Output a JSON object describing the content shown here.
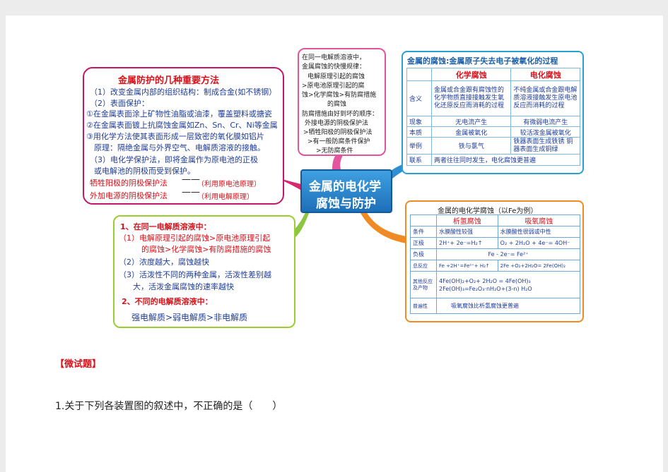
{
  "center": {
    "line1": "金属的电化学",
    "line2": "腐蚀与防护"
  },
  "protection": {
    "title": "金属防护的几种重要方法",
    "lines": [
      "（1）改变金属内部的组织结构：制成合金(如不锈钢）",
      "（2）表面保护：",
      "①在金属表面涂上矿物性油脂或油漆，覆盖塑料或搪瓷",
      "②在金属表面镀上抗腐蚀金属如Zn、Sn、Cr、Ni等金属",
      "③用化学方法使其表面形成一层致密的氧化膜如铝片",
      "原理：隔绝金属与外界空气、电解质溶液的接触。",
      "（3）电化学保护法，即将金属作为原电池的正极",
      "或电解池的阴极而受到保护。"
    ],
    "sac": "牺牲阳极的阴极保护法",
    "sac_note": "（利用原电池原理）",
    "ext": "外加电源的阴极保护法",
    "ext_note": "（利用电解原理）"
  },
  "rules": {
    "lines": [
      "在同一电解质溶液中，",
      "金属腐蚀的快慢规律：",
      "电解原理引起的腐蚀",
      ">原电池原理引起的腐",
      "蚀>化学腐蚀>有防腐措施",
      "的腐蚀",
      "防腐措施由好到坏的顺序：",
      "外接电源的阴极保护法",
      ">牺牲阳极的阴极保护法",
      ">有一般防腐条件保护",
      ">无防腐条件"
    ]
  },
  "corrosion_table": {
    "title": "金属的腐蚀:金属原子失去电子被氧化的过程",
    "headers": [
      "化学腐蚀",
      "电化腐蚀"
    ],
    "rows": [
      {
        "label": "含义",
        "a": "金属或合金跟有腐蚀性的化学物质直接接触发生氧化还原反应而消耗的过程",
        "b": "不纯金属或合金跟电解质溶液接触发生原电池反应而消耗的过程"
      },
      {
        "label": "现象",
        "a": "无电流产生",
        "b": "有微弱电流产生"
      },
      {
        "label": "本质",
        "a": "金属被氧化",
        "b": "较活泼金属被氧化"
      },
      {
        "label": "举例",
        "a": "铁与氯气",
        "b": "铁器表面生成铁锈 铜器表面生成铜绿"
      },
      {
        "label": "联系",
        "a": "两者往往同时发生，电化腐蚀更普遍",
        "b": ""
      }
    ]
  },
  "speed": {
    "title1": "1、在同一电解质溶液中：",
    "l1": "（1）电解原理引起的腐蚀>原电池原理引起",
    "l1b": "的腐蚀>化学腐蚀>有防腐措施的腐蚀",
    "l2": "（2）浓度越大，腐蚀越快",
    "l3": "（3）活泼性不同的两种金属，活泼性差别越",
    "l3b": "大，活泼金属腐蚀的速率越快",
    "title2": "2、不同的电解质溶液中：",
    "l4": "强电解质>弱电解质>非电解质"
  },
  "fe_table": {
    "title": "金属的电化学腐蚀（以Fe为例）",
    "headers": [
      "析氢腐蚀",
      "吸氧腐蚀"
    ],
    "rows": [
      {
        "label": "条件",
        "a": "水膜酸性较强",
        "b": "水膜酸性很弱或中性"
      },
      {
        "label": "正极",
        "a": "2H⁺+ 2e⁻=H₂↑",
        "b": "O₂ + 2H₂O + 4e⁻= 4OH⁻"
      },
      {
        "label": "负极",
        "a": "Fe - 2e⁻= Fe²⁺",
        "b": ""
      },
      {
        "label": "总反应",
        "a": "Fe +2H⁺=Fe²⁺+ H₂↑",
        "b": "2Fe +O₂+2H₂O= 2Fe(OH)₂"
      },
      {
        "label": "其他反应及产物",
        "a": "4Fe(OH)₂+O₂+ 2H₂O = 4Fe(OH)₃",
        "b": "2Fe(OH)₃=Fe₂O₃·nH₂O+(3-n) H₂O"
      },
      {
        "label": "普遍性",
        "a": "吸氧腐蚀比析氢腐蚀更普遍",
        "b": ""
      }
    ]
  },
  "quiz": {
    "tag": "【微试题】",
    "question": "1.关于下列各装置图的叙述中，不正确的是（　　）"
  }
}
